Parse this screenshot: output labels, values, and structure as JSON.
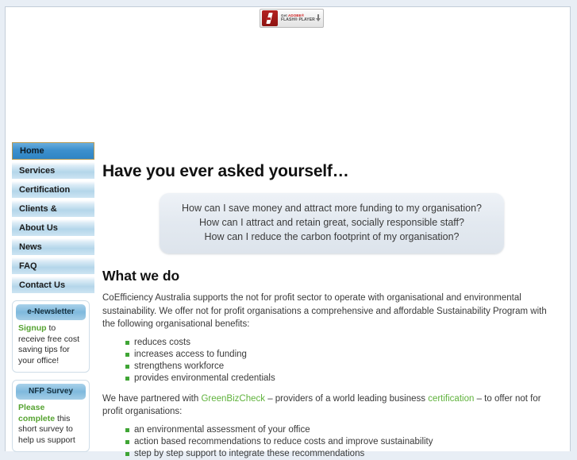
{
  "banner": {
    "flash_badge": {
      "icon": "adobe-flash-logo-icon",
      "line1_prefix": "Get ",
      "line1_brand": "ADOBE®",
      "line2": "FLASH® PLAYER",
      "download_icon": "download-arrow-icon"
    }
  },
  "sidebar": {
    "nav": [
      {
        "label": "Home",
        "active": true
      },
      {
        "label": "Services",
        "active": false
      },
      {
        "label": "Certification",
        "active": false
      },
      {
        "label": "Clients &",
        "active": false
      },
      {
        "label": "About Us",
        "active": false
      },
      {
        "label": "News",
        "active": false
      },
      {
        "label": "FAQ",
        "active": false
      },
      {
        "label": "Contact Us",
        "active": false
      }
    ],
    "cards": [
      {
        "title": "e-Newsletter",
        "link_text": "Signup",
        "body_text": " to receive free cost saving tips for your office!"
      },
      {
        "title": "NFP Survey",
        "link_text": "Please complete",
        "body_text": " this short survey to help us support"
      }
    ]
  },
  "content": {
    "page_heading": "Have you ever asked yourself…",
    "quote_lines": [
      "How can I save money and attract more funding to my organisation?",
      "How can I attract and retain great, socially responsible staff?",
      "How can I reduce the carbon footprint of my organisation?"
    ],
    "section_heading": "What we do",
    "intro_paragraph": "CoEfficiency Australia supports the not for profit sector to operate with organisational and environmental sustainability. We offer not for profit organisations a comprehensive and affordable Sustainability Program with the following organisational benefits:",
    "benefits": [
      "reduces costs",
      "increases access to funding",
      "strengthens workforce",
      "provides environmental credentials"
    ],
    "partner_paragraph": {
      "part1": "We have partnered with ",
      "link1": "GreenBizCheck",
      "part2": " – providers of a world leading business ",
      "link2": "certification",
      "part3": " – to offer not for profit organisations:"
    },
    "offerings": [
      "an environmental assessment of your office",
      "action based recommendations to reduce costs and improve sustainability",
      "step by step support to integrate these recommendations"
    ]
  },
  "colors": {
    "page_background": "#e8eef5",
    "content_background": "#ffffff",
    "nav_gradient_top": "#dbebf6",
    "nav_gradient_bottom": "#b4d6ea",
    "nav_active": "#3d90cd",
    "nav_active_border": "#b79b55",
    "green_accent": "#56a331",
    "bullet_green": "#3fa535",
    "quote_box_background": "#e3e9f0",
    "flash_red": "#b4201f"
  }
}
